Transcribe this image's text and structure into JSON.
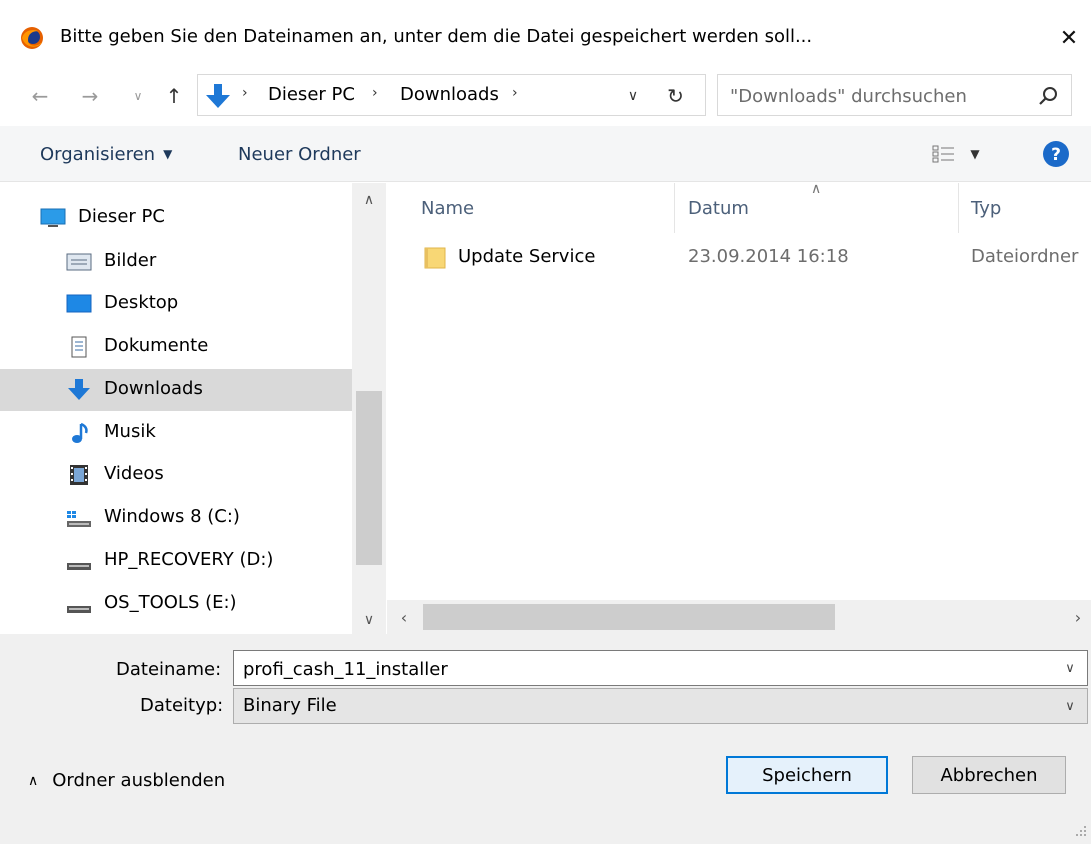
{
  "window": {
    "title": "Bitte geben Sie den Dateinamen an, unter dem die Datei gespeichert werden soll...",
    "close_glyph": "✕"
  },
  "nav": {
    "breadcrumbs": [
      "Dieser PC",
      "Downloads"
    ],
    "search_placeholder": "\"Downloads\" durchsuchen"
  },
  "toolbar": {
    "organize_label": "Organisieren",
    "new_folder_label": "Neuer Ordner"
  },
  "sidebar": {
    "root": {
      "label": "Dieser PC",
      "icon": "monitor-icon"
    },
    "items": [
      {
        "label": "Bilder",
        "icon": "pictures-icon"
      },
      {
        "label": "Desktop",
        "icon": "desktop-icon"
      },
      {
        "label": "Dokumente",
        "icon": "document-icon"
      },
      {
        "label": "Downloads",
        "icon": "download-arrow-icon",
        "selected": true
      },
      {
        "label": "Musik",
        "icon": "music-note-icon"
      },
      {
        "label": "Videos",
        "icon": "film-icon"
      },
      {
        "label": "Windows 8 (C:)",
        "icon": "windows-drive-icon"
      },
      {
        "label": "HP_RECOVERY (D:)",
        "icon": "drive-icon"
      },
      {
        "label": "OS_TOOLS (E:)",
        "icon": "drive-icon"
      }
    ]
  },
  "filelist": {
    "columns": [
      "Name",
      "Datum",
      "Typ"
    ],
    "rows": [
      {
        "name": "Update Service",
        "date": "23.09.2014 16:18",
        "type": "Dateiordner",
        "icon": "folder-icon"
      }
    ]
  },
  "footer": {
    "filename_label": "Dateiname:",
    "filename_value": "profi_cash_11_installer",
    "filetype_label": "Dateityp:",
    "filetype_value": "Binary File",
    "hide_folders_label": "Ordner ausblenden",
    "save_label": "Speichern",
    "cancel_label": "Abbrechen"
  },
  "colors": {
    "accent": "#0078d7",
    "toolbar_bg": "#f5f6f7",
    "footer_bg": "#f0f0f0",
    "selected_bg": "#d9d9d9",
    "header_text": "#4c607a"
  }
}
